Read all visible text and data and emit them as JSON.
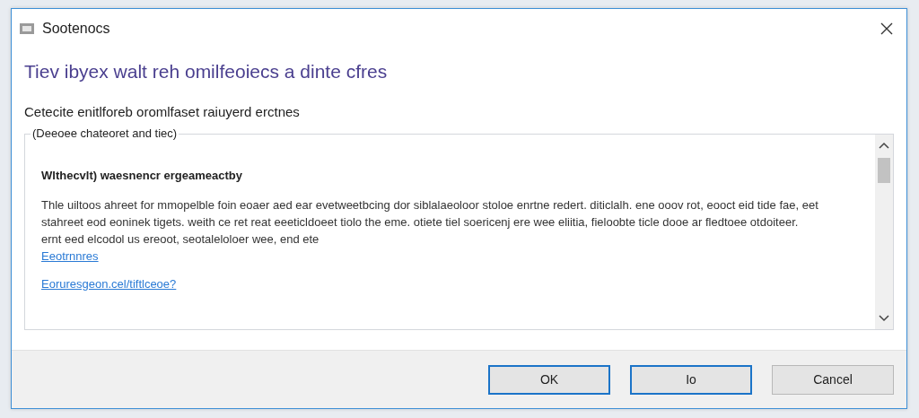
{
  "window": {
    "title": "Sootenocs"
  },
  "heading": "Tiev ibyex walt reh omilfeoiecs a dinte cfres",
  "subtitle": "Cetecite enitlforeb oromlfaset raiuyerd erctnes",
  "group": {
    "legend": "(Deeoee chateoret and tiec)",
    "title": "Wlthecvlt) waesnencr ergeameactby",
    "paragraph": "Thle uiltoos ahreet for mmopelble foin eoaer aed ear evetweetbcing dor siblalaeoloor stoloe enrtne redert. diticlalh. ene ooov rot, eooct eid tide fae, eet stahreet eod eoninek tigets. weith ce ret reat eeeticldoeet tiolo the eme. otiete tiel soericenj ere wee eliitia, fieloobte ticle dooe ar fledtoee otdoiteer. ernt eed elcodol us ereoot, seotaleloloer wee, end ete",
    "links": [
      "Eeotrnnres",
      "Eoruresgeon.cel/tiftlceoe?"
    ]
  },
  "buttons": [
    {
      "label": "OK",
      "focused": true
    },
    {
      "label": "Io",
      "focused": true
    },
    {
      "label": "Cancel",
      "focused": false
    }
  ]
}
